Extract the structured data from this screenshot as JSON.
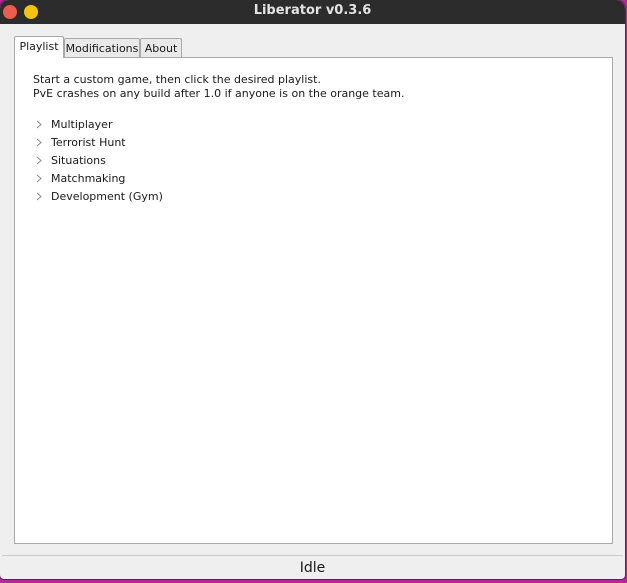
{
  "window": {
    "title": "Liberator v0.3.6"
  },
  "tabs": [
    {
      "label": "Playlist",
      "active": true
    },
    {
      "label": "Modifications",
      "active": false
    },
    {
      "label": "About",
      "active": false
    }
  ],
  "playlist": {
    "instructions": [
      "Start a custom game, then click the desired playlist.",
      "PvE crashes on any build after 1.0 if anyone is on the orange team."
    ],
    "items": [
      {
        "label": "Multiplayer",
        "expanded": false
      },
      {
        "label": "Terrorist Hunt",
        "expanded": false
      },
      {
        "label": "Situations",
        "expanded": false
      },
      {
        "label": "Matchmaking",
        "expanded": false
      },
      {
        "label": "Development (Gym)",
        "expanded": false
      }
    ]
  },
  "status": {
    "text": "Idle"
  },
  "colors": {
    "desktop_bg": "#b4289a",
    "titlebar": "#2c2c2c",
    "close_button": "#ec5d4d",
    "minimize_button": "#f2c40f"
  }
}
